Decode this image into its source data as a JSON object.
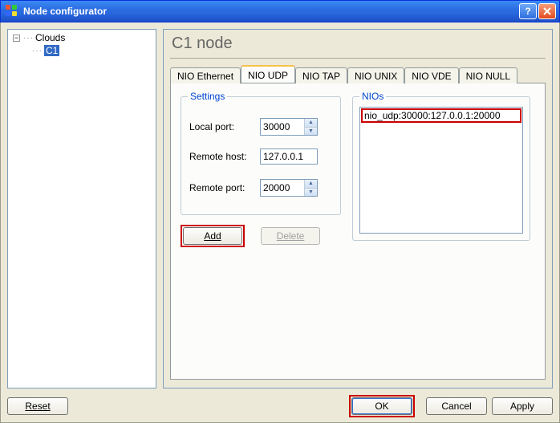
{
  "window": {
    "title": "Node configurator"
  },
  "tree": {
    "root": "Clouds",
    "selected": "C1"
  },
  "panel": {
    "title": "C1 node"
  },
  "tabs": {
    "items": [
      "NIO Ethernet",
      "NIO UDP",
      "NIO TAP",
      "NIO UNIX",
      "NIO VDE",
      "NIO NULL"
    ],
    "active_index": 1
  },
  "settings": {
    "legend": "Settings",
    "local_port_label": "Local port:",
    "local_port_value": "30000",
    "remote_host_label": "Remote host:",
    "remote_host_value": "127.0.0.1",
    "remote_port_label": "Remote port:",
    "remote_port_value": "20000"
  },
  "nios": {
    "legend": "NIOs",
    "items": [
      "nio_udp:30000:127.0.0.1:20000"
    ]
  },
  "buttons": {
    "add": "Add",
    "delete": "Delete",
    "reset": "Reset",
    "ok": "OK",
    "cancel": "Cancel",
    "apply": "Apply"
  }
}
